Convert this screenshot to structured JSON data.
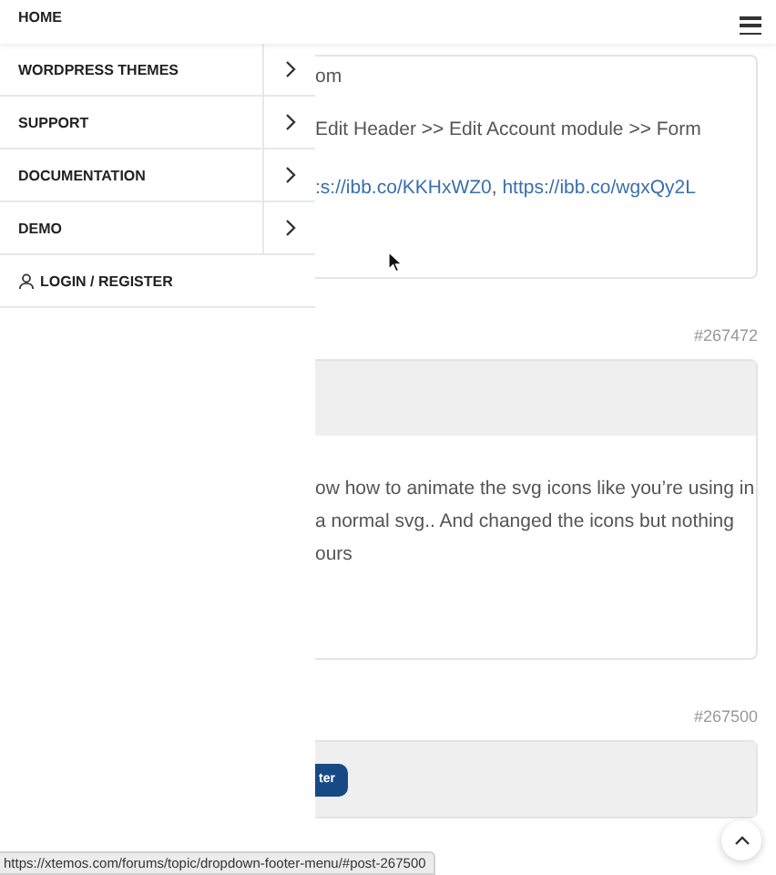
{
  "header": {
    "home": "HOME"
  },
  "drawer": {
    "items": [
      {
        "label": "WORDPRESS THEMES"
      },
      {
        "label": "SUPPORT"
      },
      {
        "label": "DOCUMENTATION"
      },
      {
        "label": "DEMO"
      }
    ],
    "login": "LOGIN / REGISTER"
  },
  "posts": [
    {
      "header": false,
      "lines": [
        "om",
        "Edit Header >> Edit Account module >> Form"
      ],
      "links": [
        ":s://ibb.co/KKHxWZ0",
        "https://ibb.co/wgxQy2L"
      ],
      "link_separator": ","
    },
    {
      "number": "#267472",
      "header": true,
      "lines": [
        "ow how to animate the svg icons like you’re using in",
        "a normal svg.. And changed the icons but nothing",
        "ours"
      ]
    },
    {
      "number": "#267500",
      "header": true,
      "button": "ter"
    }
  ],
  "status_bar": "https://xtemos.com/forums/topic/dropdown-footer-menu/#post-267500"
}
